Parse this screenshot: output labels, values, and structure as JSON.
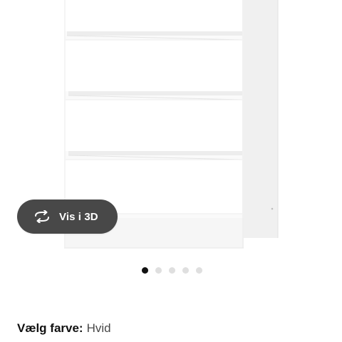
{
  "viewer": {
    "view_3d_label": "Vis i 3D",
    "slides_count": 5,
    "active_slide": 1
  },
  "color": {
    "title": "Vælg farve:",
    "value": "Hvid"
  },
  "icons": {
    "view_3d": "rotate-arrows-icon"
  },
  "colors": {
    "button_bg": "#484848",
    "dot_active": "#111111",
    "dot_inactive": "#dfdfdf"
  }
}
